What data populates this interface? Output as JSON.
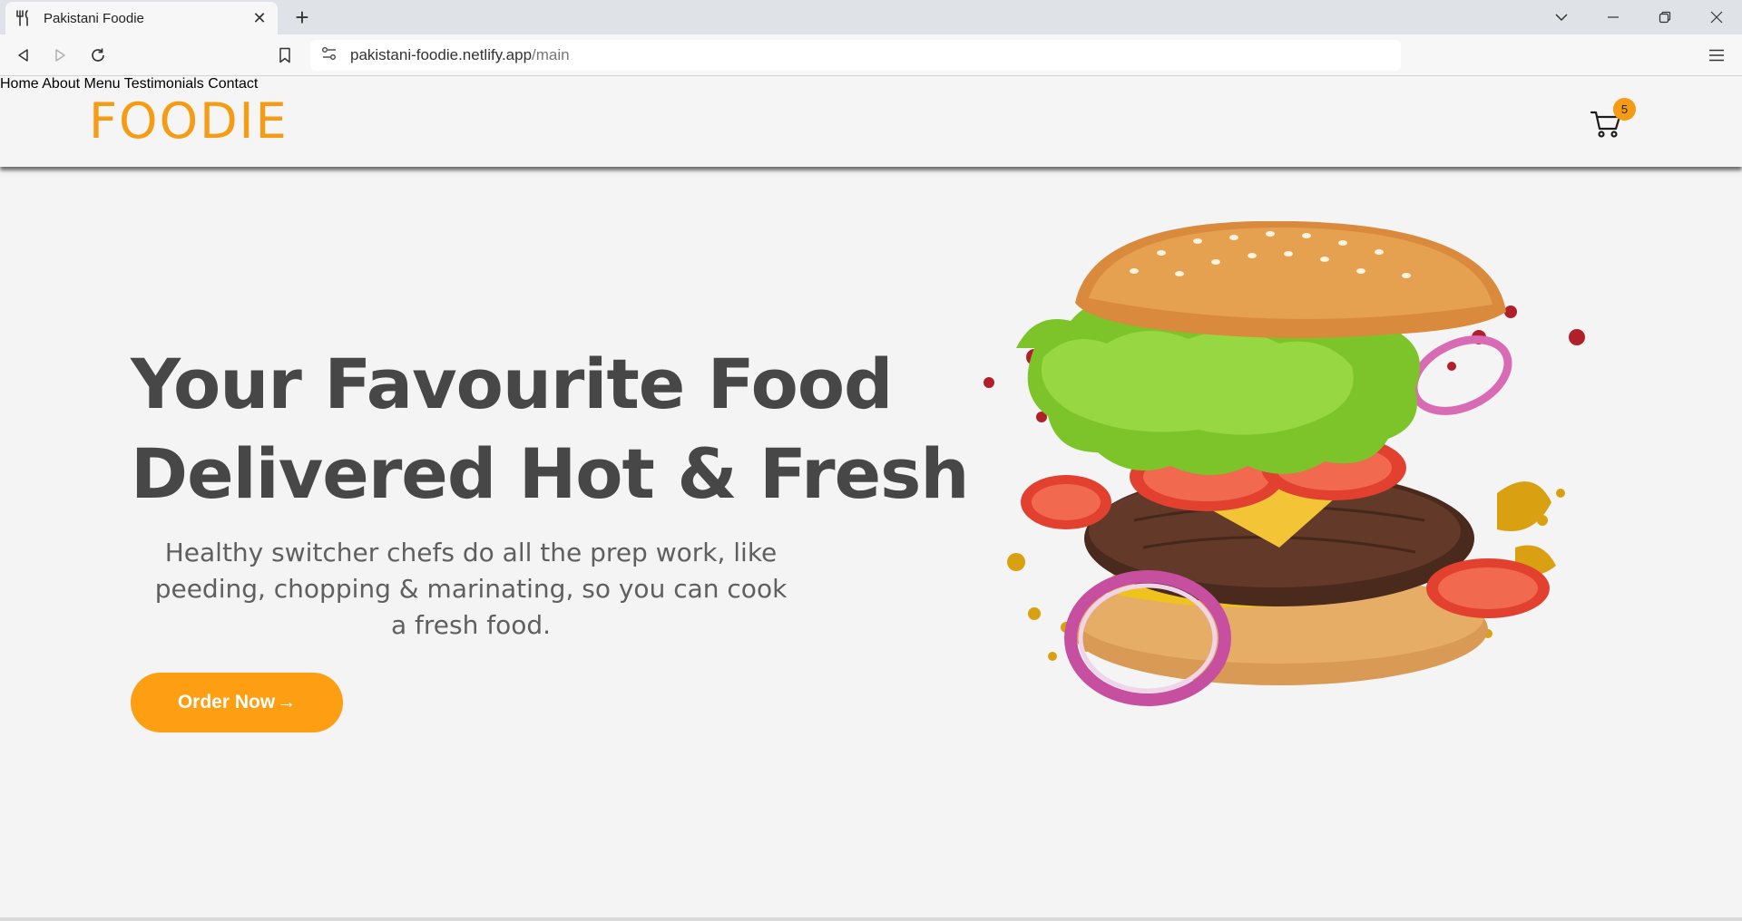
{
  "browser": {
    "tab_title": "Pakistani Foodie",
    "url_host": "pakistani-foodie.netlify.app",
    "url_path": "/main"
  },
  "site": {
    "logo": "FOODIE",
    "nav": [
      "Home",
      "About",
      "Menu",
      "Testimonials",
      "Contact"
    ],
    "cart_count": "5",
    "brand_color": "#f69b14"
  },
  "hero": {
    "title_line1": "Your Favourite Food",
    "title_line2": "Delivered Hot & Fresh",
    "subtitle": "Healthy switcher chefs do all the prep work, like peeding, chopping & marinating, so you can cook a fresh food.",
    "cta_label": "Order Now",
    "cta_arrow": "→",
    "image": "flying-burger-illustration"
  },
  "icons": [
    "fork-knife-icon",
    "close-icon",
    "plus-icon",
    "chevron-down-icon",
    "minimize-icon",
    "restore-icon",
    "back-icon",
    "forward-icon",
    "reload-icon",
    "bookmark-icon",
    "site-settings-icon",
    "menu-icon",
    "cart-icon"
  ]
}
